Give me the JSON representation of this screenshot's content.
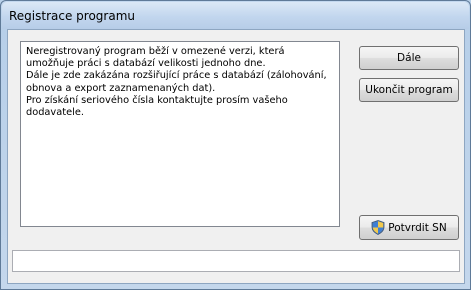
{
  "window": {
    "title": "Registrace programu"
  },
  "message": {
    "lines": [
      "Neregistrovaný program běží v omezené verzi, která umožňuje práci s databází velikosti jednoho dne.",
      "Dále je zde zakázána rozšiřující práce s databází (zálohování, obnova a export zaznamenaných dat).",
      "",
      "Pro získání seriového čísla kontaktujte prosím vašeho dodavatele."
    ]
  },
  "buttons": {
    "next_label": "Dále",
    "quit_label": "Ukončit program",
    "confirm_sn_label": "Potvrdit SN",
    "confirm_sn_icon": "uac-shield-icon"
  },
  "status_field": {
    "value": ""
  },
  "colors": {
    "frame": "#b9d1ea",
    "client": "#f0f0f0",
    "text": "#000000"
  }
}
